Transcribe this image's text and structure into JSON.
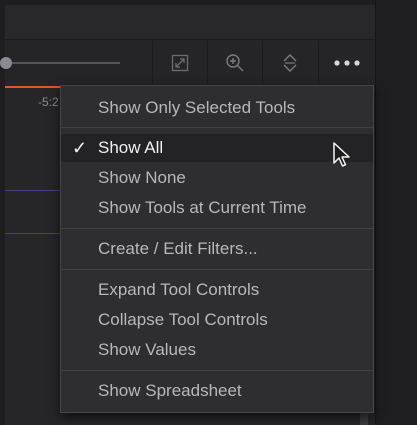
{
  "timeline": {
    "time_label": "-5:2"
  },
  "toolbar": {
    "buttons": [
      {
        "name": "expand-icon"
      },
      {
        "name": "zoom-in-icon"
      },
      {
        "name": "expand-collapse-icon"
      },
      {
        "name": "more-options-icon"
      }
    ],
    "slider_value": 0
  },
  "menu": {
    "items": [
      {
        "label": "Show Only Selected Tools",
        "checked": false
      },
      {
        "label": "Show All",
        "checked": true,
        "check_glyph": "✓"
      },
      {
        "label": "Show None",
        "checked": false
      },
      {
        "label": "Show Tools at Current Time",
        "checked": false
      },
      {
        "label": "Create / Edit Filters...",
        "checked": false
      },
      {
        "label": "Expand Tool Controls",
        "checked": false
      },
      {
        "label": "Collapse Tool Controls",
        "checked": false
      },
      {
        "label": "Show Values",
        "checked": false
      },
      {
        "label": "Show Spreadsheet",
        "checked": false
      }
    ]
  },
  "colors": {
    "accent": "#e4562a",
    "menu_bg": "#2e2e30",
    "menu_text": "#b8b8bc",
    "selected_text": "#f0f0f2"
  }
}
